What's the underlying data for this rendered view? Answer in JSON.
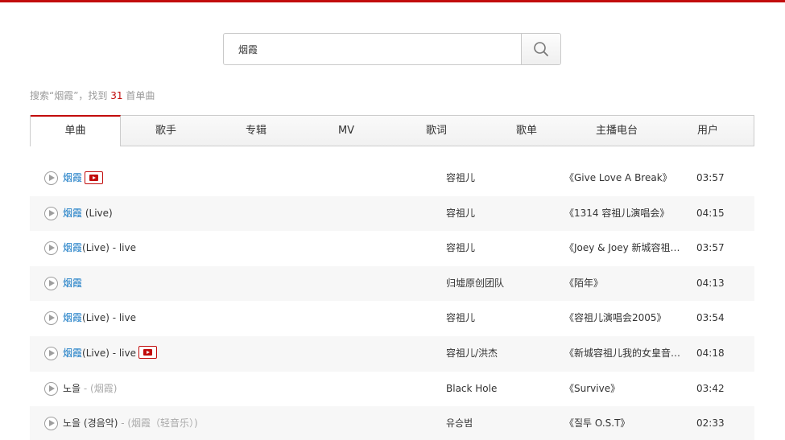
{
  "search": {
    "value": "烟霞"
  },
  "summary": {
    "prefix": "搜索“烟霞”，找到 ",
    "count": "31",
    "suffix": " 首单曲"
  },
  "tabs": [
    {
      "label": "单曲",
      "active": true
    },
    {
      "label": "歌手"
    },
    {
      "label": "专辑"
    },
    {
      "label": "MV"
    },
    {
      "label": "歌词"
    },
    {
      "label": "歌单"
    },
    {
      "label": "主播电台"
    },
    {
      "label": "用户"
    }
  ],
  "songs": [
    {
      "title": "烟霞",
      "extra": "",
      "alias": "",
      "mv": true,
      "artist": "容祖儿",
      "album": "《Give Love A Break》",
      "duration": "03:57"
    },
    {
      "title": "烟霞",
      "extra": " (Live)",
      "alias": "",
      "mv": false,
      "artist": "容祖儿",
      "album": "《1314 容祖儿演唱会》",
      "duration": "04:15"
    },
    {
      "title": "烟霞",
      "extra": "(Live) - live",
      "alias": "",
      "mv": false,
      "artist": "容祖儿",
      "album": "《Joey & Joey 新城容祖儿...",
      "duration": "03:57"
    },
    {
      "title": "烟霞",
      "extra": "",
      "alias": "",
      "mv": false,
      "artist": "归墟原创团队",
      "album": "《陌年》",
      "duration": "04:13"
    },
    {
      "title": "烟霞",
      "extra": "(Live) - live",
      "alias": "",
      "mv": false,
      "artist": "容祖儿",
      "album": "《容祖儿演唱会2005》",
      "duration": "03:54"
    },
    {
      "title": "烟霞",
      "extra": "(Live) - live",
      "alias": "",
      "mv": true,
      "artist": "容祖儿/洪杰",
      "album": "《新城容祖儿我的女皇音乐...",
      "duration": "04:18"
    },
    {
      "title": "",
      "extra": "노을",
      "alias": " - (烟霞)",
      "mv": false,
      "artist": "Black Hole",
      "album": "《Survive》",
      "duration": "03:42"
    },
    {
      "title": "",
      "extra": "노을 (경음악)",
      "alias": " - (烟霞（轻音乐）)",
      "mv": false,
      "artist": "유승범",
      "album": "《질투 O.S.T》",
      "duration": "02:33"
    }
  ],
  "colors": {
    "accent": "#c20c0c",
    "link": "#0c73c2"
  }
}
